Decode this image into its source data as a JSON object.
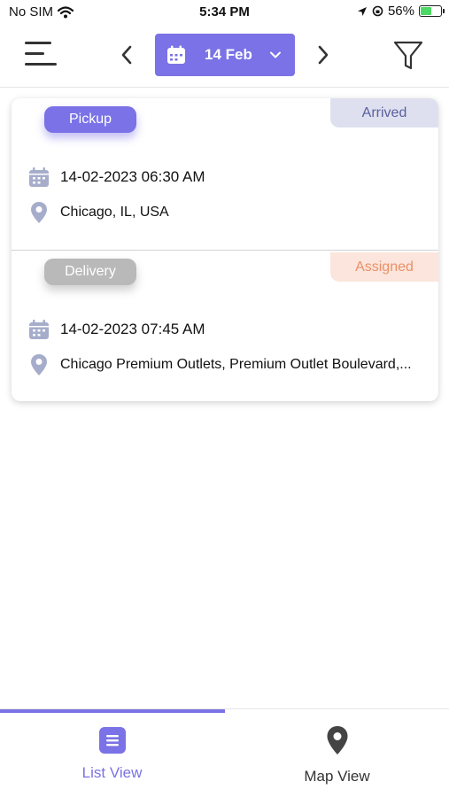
{
  "status_bar": {
    "carrier": "No SIM",
    "time": "5:34 PM",
    "battery": "56%",
    "battery_level": 0.56
  },
  "header": {
    "date_label": "14 Feb",
    "icons": [
      "menu-icon",
      "chevron-left-icon",
      "calendar-icon",
      "chevron-down-icon",
      "chevron-right-icon",
      "filter-icon"
    ],
    "accent_color": "#7a72e6"
  },
  "orders": [
    {
      "type": "Pickup",
      "status": "Arrived",
      "datetime": "14-02-2023 06:30 AM",
      "location": "Chicago, IL, USA",
      "status_color": "#5a5f9e"
    },
    {
      "type": "Delivery",
      "status": "Assigned",
      "datetime": "14-02-2023 07:45 AM",
      "location": "Chicago Premium Outlets, Premium Outlet Boulevard,...",
      "status_color": "#e99067"
    }
  ],
  "tabs": [
    {
      "label": "List View",
      "icon": "list-icon",
      "active": true
    },
    {
      "label": "Map View",
      "icon": "map-pin-icon",
      "active": false
    }
  ]
}
